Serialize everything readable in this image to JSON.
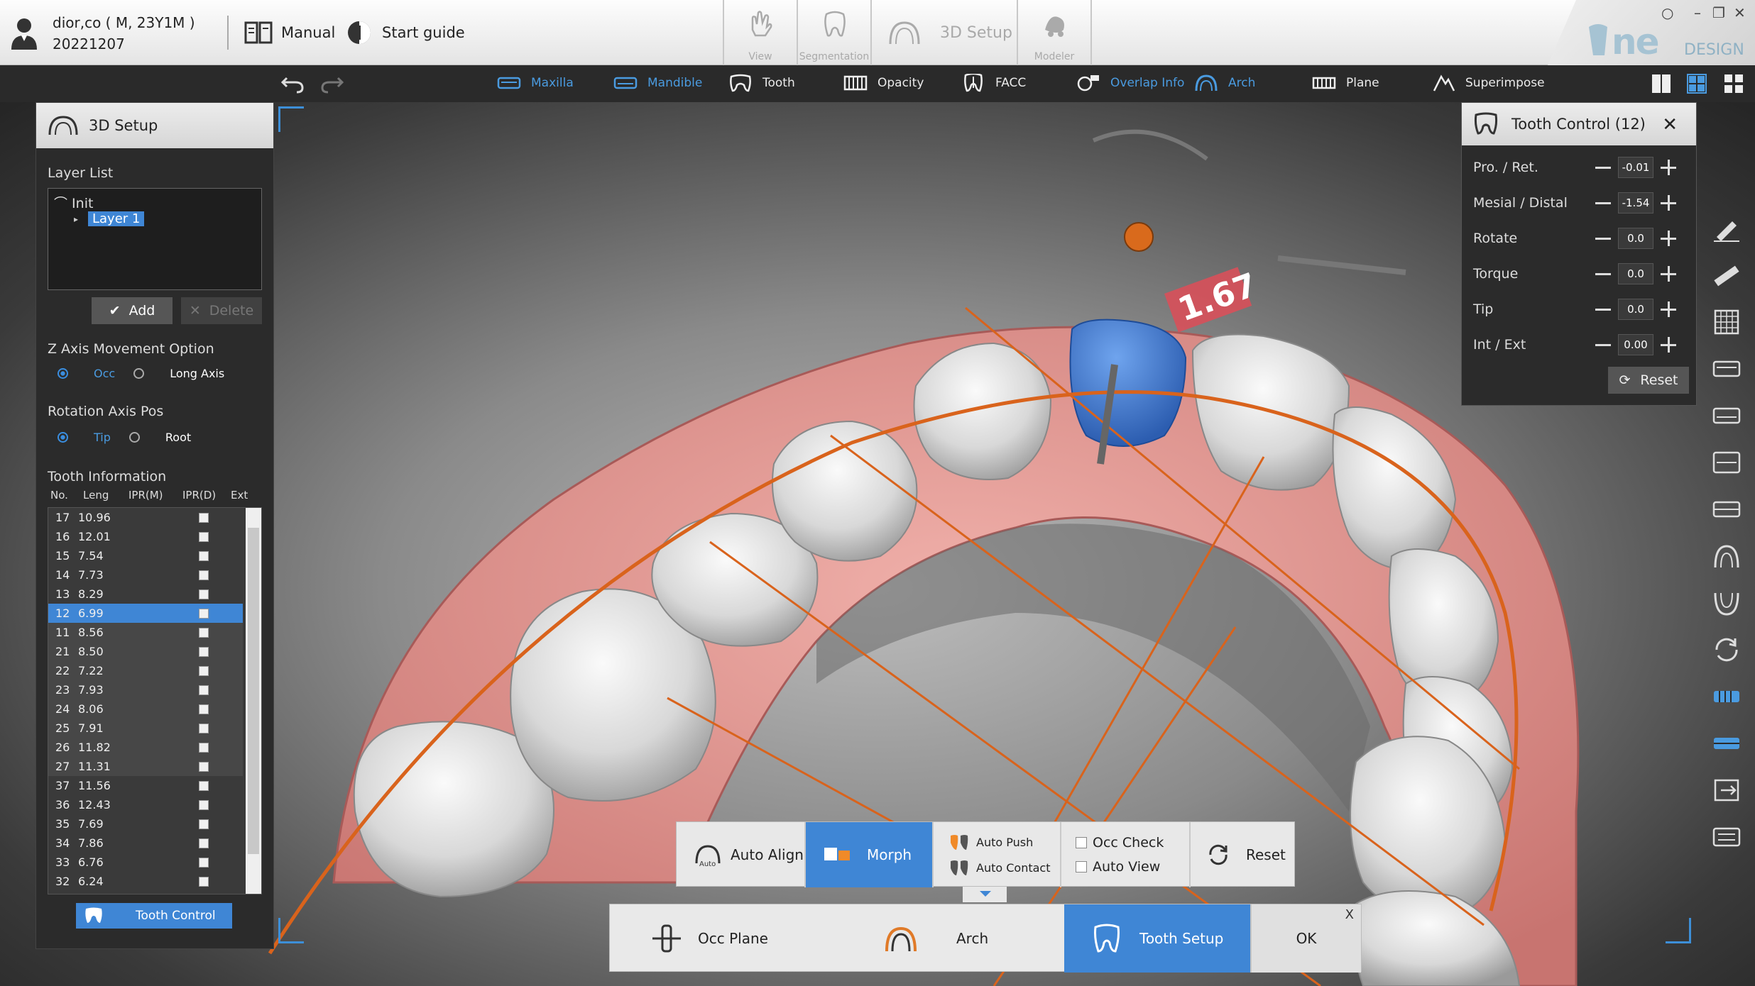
{
  "header": {
    "patient_name": "dior,co ( M, 23Y1M )",
    "patient_date": "20221207",
    "manual_label": "Manual",
    "start_guide_label": "Start guide",
    "mode_tabs": {
      "view": "View",
      "segmentation": "Segmentation",
      "setup": "3D Setup",
      "modeler": "Modeler"
    },
    "brand_logo": "ne",
    "brand_sub": "DESIGN",
    "window_controls": {
      "help": "○",
      "minimize": "–",
      "maximize": "❐",
      "close": "✕"
    }
  },
  "toolbar": {
    "maxilla": "Maxilla",
    "mandible": "Mandible",
    "tooth": "Tooth",
    "opacity": "Opacity",
    "facc": "FACC",
    "overlap_info": "Overlap Info",
    "arch": "Arch",
    "plane": "Plane",
    "superimpose": "Superimpose"
  },
  "left_panel": {
    "title": "3D Setup",
    "layer_list_label": "Layer List",
    "layer_root": "Init",
    "layer_selected": "Layer 1",
    "add_label": "Add",
    "delete_label": "Delete",
    "z_axis_label": "Z Axis Movement Option",
    "z_axis_options": [
      "Occ",
      "Long Axis"
    ],
    "rotation_label": "Rotation Axis Pos",
    "rotation_options": [
      "Tip",
      "Root"
    ],
    "tooth_info_label": "Tooth Information",
    "columns": [
      "No.",
      "Leng",
      "IPR(M)",
      "IPR(D)",
      "Ext"
    ],
    "rows": [
      {
        "no": "17",
        "len": "10.96"
      },
      {
        "no": "16",
        "len": "12.01"
      },
      {
        "no": "15",
        "len": "7.54"
      },
      {
        "no": "14",
        "len": "7.73"
      },
      {
        "no": "13",
        "len": "8.29"
      },
      {
        "no": "12",
        "len": "6.99"
      },
      {
        "no": "11",
        "len": "8.56"
      },
      {
        "no": "21",
        "len": "8.50"
      },
      {
        "no": "22",
        "len": "7.22"
      },
      {
        "no": "23",
        "len": "7.93"
      },
      {
        "no": "24",
        "len": "8.06"
      },
      {
        "no": "25",
        "len": "7.91"
      },
      {
        "no": "26",
        "len": "11.82"
      },
      {
        "no": "27",
        "len": "11.31"
      },
      {
        "no": "37",
        "len": "11.56"
      },
      {
        "no": "36",
        "len": "12.43"
      },
      {
        "no": "35",
        "len": "7.69"
      },
      {
        "no": "34",
        "len": "7.86"
      },
      {
        "no": "33",
        "len": "6.76"
      },
      {
        "no": "32",
        "len": "6.24"
      }
    ],
    "selected_tooth": "12",
    "tooth_control_btn": "Tooth Control"
  },
  "viewport": {
    "distance_label": "1.67"
  },
  "tooth_control": {
    "title": "Tooth Control (12)",
    "close": "✕",
    "rows": [
      {
        "label": "Pro. / Ret.",
        "value": "-0.01"
      },
      {
        "label": "Mesial / Distal",
        "value": "-1.54"
      },
      {
        "label": "Rotate",
        "value": "0.0"
      },
      {
        "label": "Torque",
        "value": "0.0"
      },
      {
        "label": "Tip",
        "value": "0.0"
      },
      {
        "label": "Int / Ext",
        "value": "0.00"
      }
    ],
    "reset_label": "Reset"
  },
  "actions": {
    "auto_align": "Auto Align",
    "auto_badge": "Auto",
    "morph": "Morph",
    "auto_push": "Auto Push",
    "auto_contact": "Auto Contact",
    "occ_check": "Occ Check",
    "auto_view": "Auto View",
    "reset": "Reset"
  },
  "wizard": {
    "occ_plane": "Occ Plane",
    "arch": "Arch",
    "tooth_setup": "Tooth Setup",
    "ok": "OK",
    "close": "X"
  },
  "colors": {
    "accent_blue": "#3f86d5",
    "arch_orange": "#d9631c",
    "gum_pink": "#e59a96",
    "selected_tooth": "#4a86dc",
    "ipr_red": "#d8505a"
  }
}
